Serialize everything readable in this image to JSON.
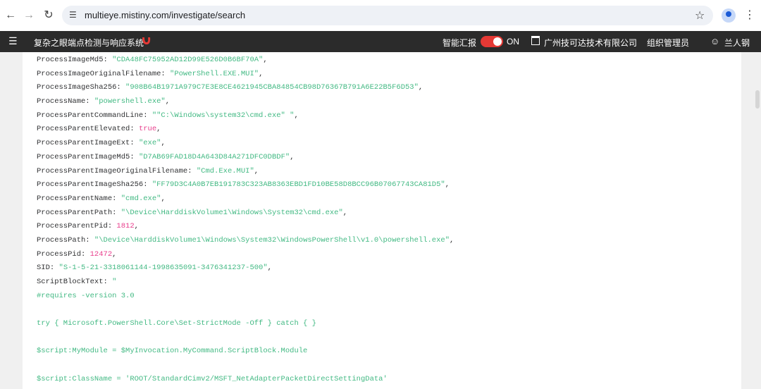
{
  "browser": {
    "url": "multieye.mistiny.com/investigate/search",
    "back_icon": "arrow-left-icon",
    "forward_icon": "arrow-right-icon",
    "reload_icon": "reload-icon"
  },
  "header": {
    "title": "复杂之眼端点检测与响应系统",
    "report_label": "智能汇报",
    "toggle_state": "ON",
    "company": "广州技可达技术有限公司",
    "org_admin": "组织管理员",
    "user": "兰人钢",
    "accent": "#e53935"
  },
  "lines": [
    {
      "key": "ProcessImageMd5",
      "val": "\"CDA48FC75952AD12D99E526D0B6BF70A\"",
      "type": "s"
    },
    {
      "key": "ProcessImageOriginalFilename",
      "val": "\"PowerShell.EXE.MUI\"",
      "type": "s"
    },
    {
      "key": "ProcessImageSha256",
      "val": "\"908B64B1971A979C7E3E8CE4621945CBA84854CB98D76367B791A6E22B5F6D53\"",
      "type": "s"
    },
    {
      "key": "ProcessName",
      "val": "\"powershell.exe\"",
      "type": "s"
    },
    {
      "key": "ProcessParentCommandLine",
      "val": "\"\"C:\\Windows\\system32\\cmd.exe\" \"",
      "type": "s"
    },
    {
      "key": "ProcessParentElevated",
      "val": "true",
      "type": "b"
    },
    {
      "key": "ProcessParentImageExt",
      "val": "\"exe\"",
      "type": "s"
    },
    {
      "key": "ProcessParentImageMd5",
      "val": "\"D7AB69FAD18D4A643D84A271DFC0DBDF\"",
      "type": "s"
    },
    {
      "key": "ProcessParentImageOriginalFilename",
      "val": "\"Cmd.Exe.MUI\"",
      "type": "s"
    },
    {
      "key": "ProcessParentImageSha256",
      "val": "\"FF79D3C4A0B7EB191783C323AB8363EBD1FD10BE58D8BCC96B07067743CA81D5\"",
      "type": "s"
    },
    {
      "key": "ProcessParentName",
      "val": "\"cmd.exe\"",
      "type": "s"
    },
    {
      "key": "ProcessParentPath",
      "val": "\"\\Device\\HarddiskVolume1\\Windows\\System32\\cmd.exe\"",
      "type": "s"
    },
    {
      "key": "ProcessParentPid",
      "val": "1812",
      "type": "n"
    },
    {
      "key": "ProcessPath",
      "val": "\"\\Device\\HarddiskVolume1\\Windows\\System32\\WindowsPowerShell\\v1.0\\powershell.exe\"",
      "type": "s"
    },
    {
      "key": "ProcessPid",
      "val": "12472",
      "type": "n"
    },
    {
      "key": "SID",
      "val": "\"S-1-5-21-3318061144-1998635091-3476341237-500\"",
      "type": "s"
    },
    {
      "key": "ScriptBlockText",
      "val": "\"",
      "type": "s"
    }
  ],
  "script_lines": [
    "#requires -version 3.0",
    "",
    "try { Microsoft.PowerShell.Core\\Set-StrictMode -Off } catch { }",
    "",
    "$script:MyModule = $MyInvocation.MyCommand.ScriptBlock.Module",
    "",
    "$script:ClassName = 'ROOT/StandardCimv2/MSFT_NetAdapterPacketDirectSettingData'"
  ]
}
